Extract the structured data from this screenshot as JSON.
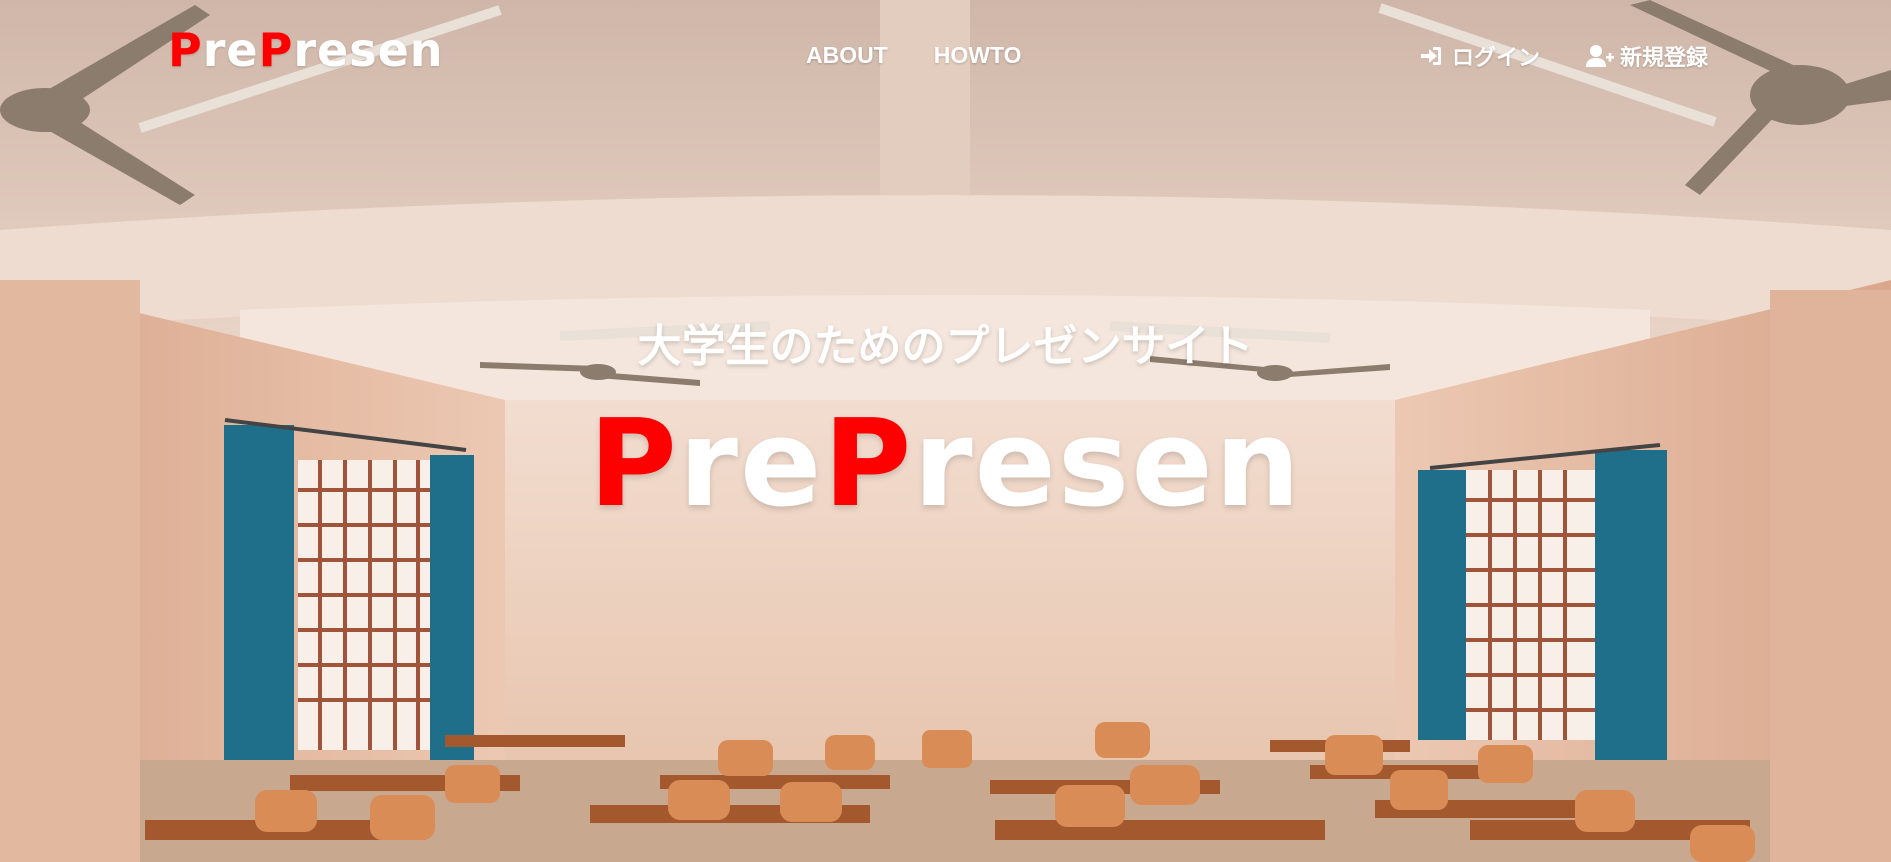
{
  "navbar": {
    "brand": {
      "part1": "P",
      "part2": "re",
      "part3": "P",
      "part4": "resen"
    },
    "links": [
      {
        "label": "ABOUT"
      },
      {
        "label": "HOWTO"
      }
    ],
    "login_label": "ログイン",
    "signup_label": "新規登録"
  },
  "hero": {
    "tagline": "大学生のためのプレゼンサイト",
    "title": {
      "part1": "P",
      "part2": "re",
      "part3": "P",
      "part4": "resen"
    }
  },
  "colors": {
    "accent": "#ff0000",
    "text": "#ffffff",
    "curtain": "#1f6f8b"
  },
  "icons": {
    "login": "sign-in-icon",
    "signup": "user-plus-icon"
  }
}
